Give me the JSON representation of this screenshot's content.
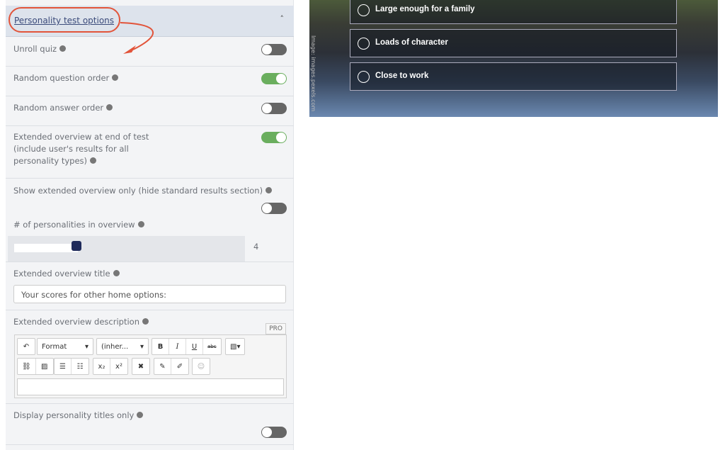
{
  "section": {
    "title": "Personality test options",
    "collapse_icon": "chevron-up-icon",
    "annotation_color": "#e2543a"
  },
  "options": [
    {
      "label": "Unroll quiz",
      "on": false
    },
    {
      "label": "Random question order",
      "on": true
    },
    {
      "label": "Random answer order",
      "on": false
    },
    {
      "label": "Extended overview at end of test (include user's results for all personality types)",
      "on": true
    },
    {
      "label": "Show extended overview only (hide standard results section)",
      "on": false
    }
  ],
  "personalities": {
    "label": "# of personalities in overview",
    "value": "4"
  },
  "overview_title": {
    "label": "Extended overview title",
    "value": "Your scores for other home options:"
  },
  "overview_desc": {
    "label": "Extended overview description",
    "badge": "PRO",
    "format": "Format",
    "font": "(inher...",
    "bold": "B",
    "italic": "I",
    "underline": "U",
    "strike": "abc"
  },
  "titles_only": {
    "label": "Display personality titles only",
    "on": false
  },
  "preview": {
    "answers": [
      "Large enough for a family",
      "Loads of character",
      "Close to work"
    ],
    "credit": "Image: images.pexels.com"
  },
  "colors": {
    "toggle_on": "#6aae5e",
    "toggle_off": "#666666",
    "slider_thumb": "#1e2a5a"
  }
}
